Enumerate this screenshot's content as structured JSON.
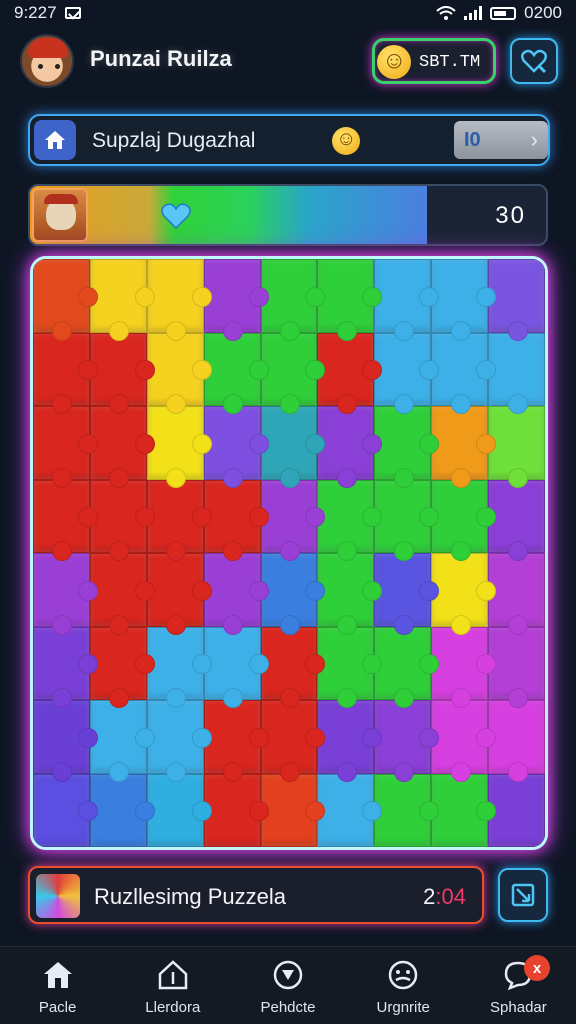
{
  "status_bar": {
    "time": "9:227",
    "right_text": "0200"
  },
  "header": {
    "title": "Punzai Ruilza",
    "coin_label": "SBT.TM",
    "avatar_icon": "avatar-adventurer",
    "heart_icon": "heart-search-icon"
  },
  "search_bar": {
    "text": "Supzlaj Dugazhal",
    "level_label": "I0",
    "chevron": "›"
  },
  "progress": {
    "value_text": "30",
    "fill_fraction": 0.77
  },
  "board": {
    "columns": 9,
    "rows": 8,
    "pieces": [
      "#e24a1e",
      "#f5d21f",
      "#f5d21f",
      "#9a3fd6",
      "#2fcf3a",
      "#2fcf3a",
      "#3db0e8",
      "#3db0e8",
      "#7a55e0",
      "#d9261e",
      "#d9261e",
      "#f5d21f",
      "#2fcf3a",
      "#2fcf3a",
      "#d9261e",
      "#3db0e8",
      "#3db0e8",
      "#3db0e8",
      "#d9261e",
      "#d9261e",
      "#f2e018",
      "#7e4fe0",
      "#2fa6b8",
      "#8a3fd6",
      "#2fcf3a",
      "#f09a1a",
      "#6fe03a",
      "#d9261e",
      "#d9261e",
      "#d9261e",
      "#d9261e",
      "#9a3fd6",
      "#2fcf3a",
      "#2fcf3a",
      "#2fcf3a",
      "#8a3fd6",
      "#9a3fd6",
      "#d9261e",
      "#d9261e",
      "#9a3fd6",
      "#3a7ee0",
      "#2fcf3a",
      "#5a55e0",
      "#f2e018",
      "#b33fd6",
      "#7a3fd6",
      "#d9261e",
      "#3db0e8",
      "#3db0e8",
      "#d9261e",
      "#2fcf3a",
      "#2fcf3a",
      "#d63fe0",
      "#b33fd6",
      "#6a3fd6",
      "#3db0e8",
      "#3db0e8",
      "#d9261e",
      "#d9261e",
      "#7a3fd6",
      "#8a3fd6",
      "#d63fe0",
      "#d63fe0",
      "#5a4fe0",
      "#3a7ee0",
      "#2faee0",
      "#d9261e",
      "#e2401e",
      "#3db0e8",
      "#2fcf3a",
      "#2fcf3a",
      "#7a3fd6"
    ]
  },
  "info_bar": {
    "text": "Ruzllesimg Puzzela",
    "time": "2:04",
    "time_prefix": "2",
    "time_suffix": ":04"
  },
  "nav": {
    "items": [
      {
        "label": "Pacle",
        "icon": "home-icon"
      },
      {
        "label": "Llerdora",
        "icon": "house-outline-icon"
      },
      {
        "label": "Pehdcte",
        "icon": "compass-icon"
      },
      {
        "label": "Urgnrite",
        "icon": "face-icon"
      },
      {
        "label": "Sphadar",
        "icon": "chat-icon"
      }
    ],
    "badge": "x"
  },
  "colors": {
    "background": "#0e1623",
    "accent_blue": "#3fb9f2",
    "accent_green": "#39d26a",
    "accent_magenta": "#e23fe0",
    "badge_red": "#e8412e"
  }
}
